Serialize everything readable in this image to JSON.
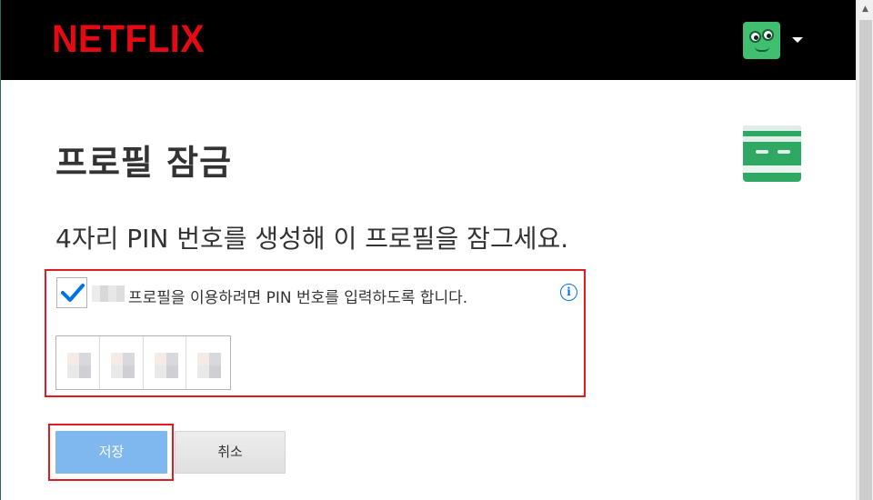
{
  "header": {
    "logo_text": "NETFLIX",
    "avatar_icon": "green-character-avatar-icon",
    "menu_caret_icon": "caret-down-icon"
  },
  "main": {
    "title": "프로필 잠금",
    "subtitle": "4자리 PIN 번호를 생성해 이 프로필을 잠그세요.",
    "profile_icon": "profile-thumbnail-icon",
    "lock_option": {
      "checked": true,
      "label": "프로필을 이용하려면 PIN 번호를 입력하도록 합니다.",
      "info_glyph": "i"
    },
    "pin_digits_count": 4
  },
  "actions": {
    "save_label": "저장",
    "cancel_label": "취소"
  },
  "colors": {
    "brand_red": "#e50914",
    "topbar_bg": "#000000",
    "save_button_bg": "#7fb8ee",
    "checkmark_blue": "#0071eb",
    "highlight_red": "#e01b22",
    "avatar_green": "#3fbf6f"
  }
}
